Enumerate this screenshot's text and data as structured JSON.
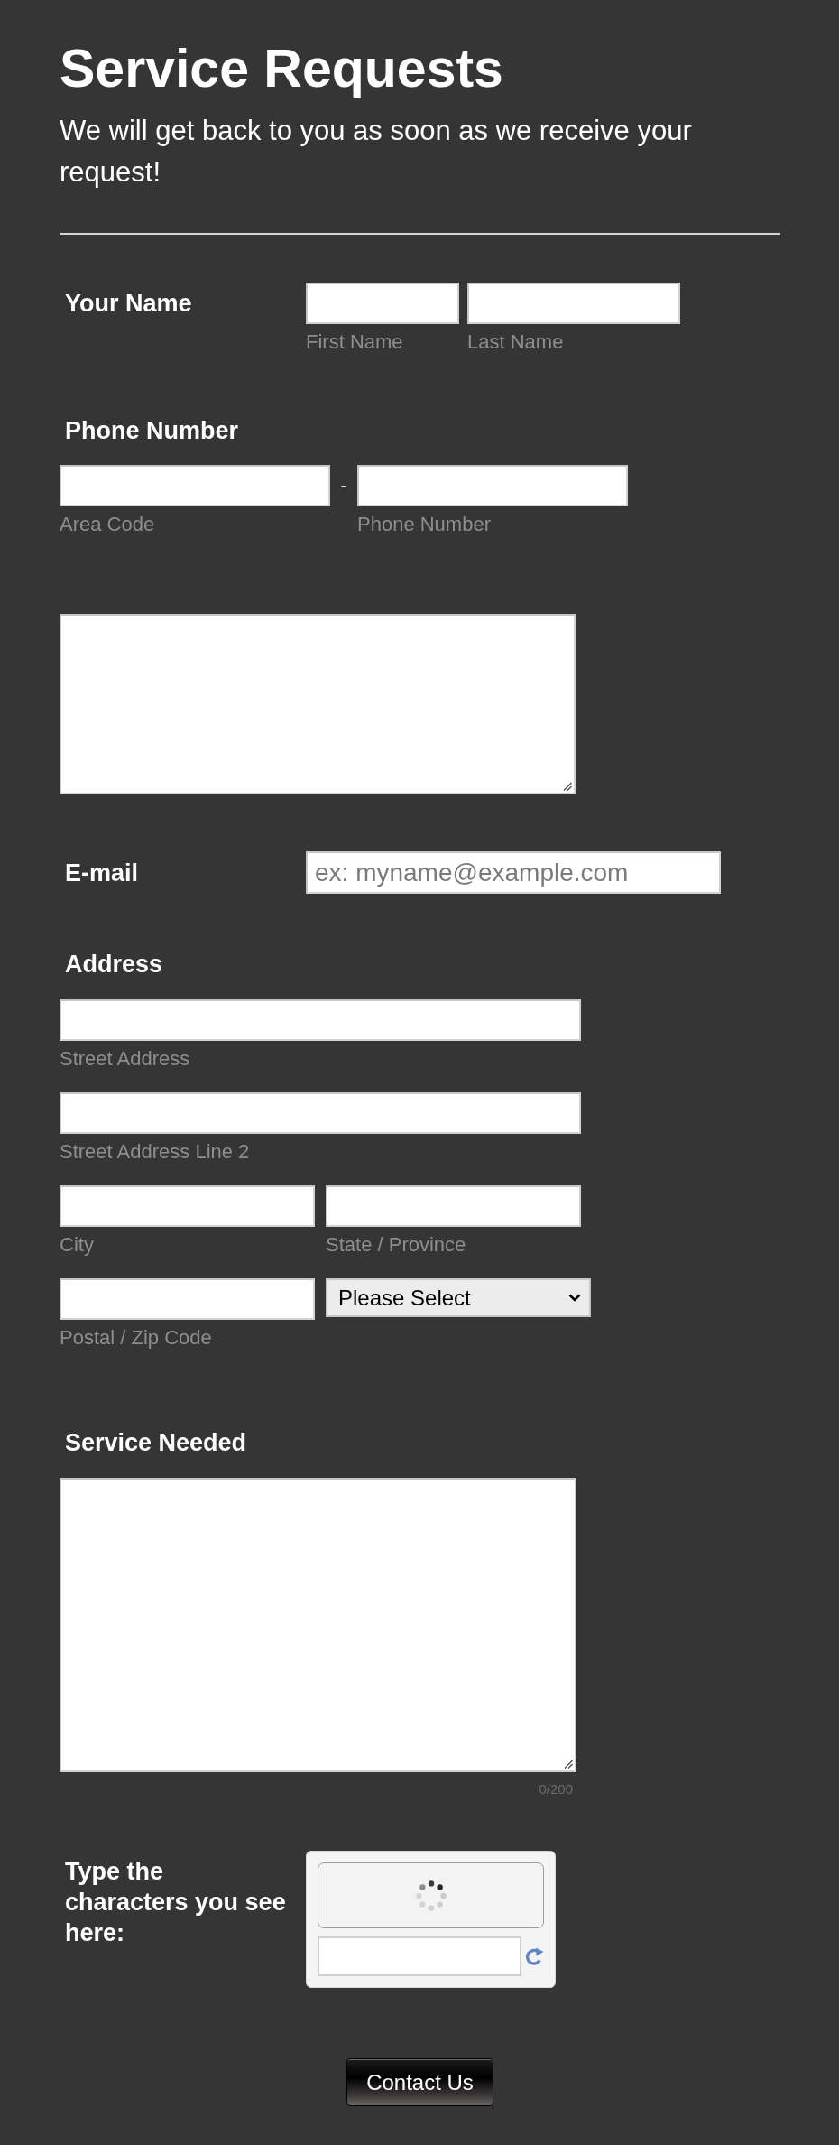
{
  "header": {
    "title": "Service Requests",
    "subtitle": "We will get back to you as soon as we receive your request!"
  },
  "fields": [
    {
      "kind": "name",
      "label": "Your Name",
      "inputs": [
        {
          "sublabel": "First Name"
        },
        {
          "sublabel": "Last Name"
        }
      ]
    },
    {
      "kind": "phone",
      "label": "Phone Number",
      "separator": "-",
      "inputs": [
        {
          "sublabel": "Area Code"
        },
        {
          "sublabel": "Phone Number"
        }
      ]
    },
    {
      "kind": "textarea"
    },
    {
      "kind": "email",
      "label": "E-mail",
      "placeholder": "ex: myname@example.com"
    },
    {
      "kind": "address",
      "label": "Address",
      "lines": [
        {
          "inputs": [
            {
              "kind": "text",
              "sublabel": "Street Address"
            }
          ]
        },
        {
          "inputs": [
            {
              "kind": "text",
              "sublabel": "Street Address Line 2"
            }
          ]
        },
        {
          "inputs": [
            {
              "kind": "text",
              "sublabel": "City"
            },
            {
              "kind": "text",
              "sublabel": "State / Province"
            }
          ]
        },
        {
          "inputs": [
            {
              "kind": "text",
              "sublabel": "Postal / Zip Code"
            },
            {
              "kind": "select",
              "value": "Please Select"
            }
          ]
        }
      ]
    },
    {
      "kind": "textarea",
      "label": "Service Needed",
      "counter": "0/200"
    },
    {
      "kind": "captcha",
      "label": "Type the characters you see here:"
    }
  ],
  "submit": {
    "label": "Contact Us"
  }
}
